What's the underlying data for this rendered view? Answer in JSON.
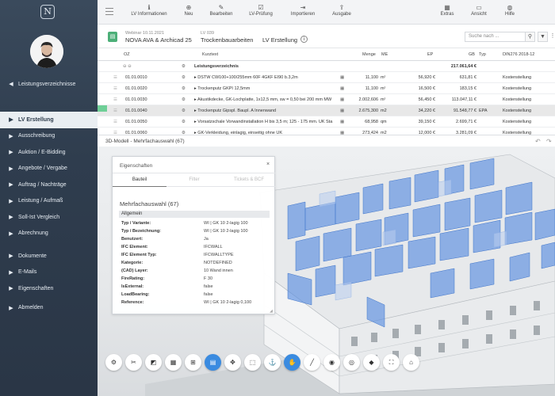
{
  "sidebar": {
    "logo": "N",
    "items": [
      {
        "label": "Leistungsverzeichnisse",
        "icon": "chevron-left-icon",
        "glyph": "◀"
      },
      {
        "label": "LV Erstellung",
        "icon": "chevron-right-icon",
        "glyph": "▶"
      },
      {
        "label": "Ausschreibung",
        "icon": "chevron-right-icon",
        "glyph": "▶"
      },
      {
        "label": "Auktion / E-Bidding",
        "icon": "chevron-right-icon",
        "glyph": "▶"
      },
      {
        "label": "Angebote / Vergabe",
        "icon": "chevron-right-icon",
        "glyph": "▶"
      },
      {
        "label": "Auftrag / Nachträge",
        "icon": "chevron-right-icon",
        "glyph": "▶"
      },
      {
        "label": "Leistung / Aufmaß",
        "icon": "chevron-right-icon",
        "glyph": "▶"
      },
      {
        "label": "Soll-Ist Vergleich",
        "icon": "chevron-right-icon",
        "glyph": "▶"
      },
      {
        "label": "Abrechnung",
        "icon": "chevron-right-icon",
        "glyph": "▶"
      },
      {
        "label": "Dokumente",
        "icon": "chevron-right-icon",
        "glyph": "▶"
      },
      {
        "label": "E-Mails",
        "icon": "chevron-right-icon",
        "glyph": "▶"
      },
      {
        "label": "Eigenschaften",
        "icon": "chevron-right-icon",
        "glyph": "▶"
      },
      {
        "label": "Abmelden",
        "icon": "chevron-right-icon",
        "glyph": "▶"
      }
    ]
  },
  "toolbar": {
    "buttons": [
      {
        "label": "LV Informationen",
        "icon": "info-icon",
        "glyph": "ℹ"
      },
      {
        "label": "Neu",
        "icon": "plus-circle-icon",
        "glyph": "⊕"
      },
      {
        "label": "Bearbeiten",
        "icon": "pencil-icon",
        "glyph": "✎"
      },
      {
        "label": "LV-Prüfung",
        "icon": "check-square-icon",
        "glyph": "☑"
      },
      {
        "label": "Importieren",
        "icon": "import-icon",
        "glyph": "⇥"
      },
      {
        "label": "Ausgabe",
        "icon": "export-icon",
        "glyph": "⇪"
      },
      {
        "label": "Extras",
        "icon": "calculator-icon",
        "glyph": "▦"
      },
      {
        "label": "Ansicht",
        "icon": "view-icon",
        "glyph": "▭"
      },
      {
        "label": "Hilfe",
        "icon": "lifebuoy-icon",
        "glyph": "◍"
      }
    ]
  },
  "header": {
    "project_date": "Webinar 10.11.2021",
    "project_name": "NOVA AVA & Archicad 25",
    "lv_code": "LV 039",
    "lv_name": "Trockenbauarbeiten",
    "lv_mode": "LV Erstellung",
    "search_placeholder": "Suche nach ..."
  },
  "table": {
    "headers": {
      "oz": "OZ",
      "kurztext": "Kurztext",
      "menge": "Menge",
      "me": "ME",
      "ep": "EP",
      "gb": "GB",
      "typ": "Typ",
      "din": "DIN276 2018-12"
    },
    "title_row": {
      "kurztext": "Leistungsverzeichnis",
      "gb": "217.061,64 €"
    },
    "rows": [
      {
        "oz": "01.01.0010",
        "kurztext": "DSTW CW100+100/255mm 60F 4GKF EI90 b.3,2m",
        "menge": "11,100",
        "me": "m²",
        "ep": "56,920 €",
        "gb": "631,81 €",
        "typ": "",
        "din": "Kostenstellung"
      },
      {
        "oz": "01.01.0020",
        "kurztext": "Trockenputz GKPI 12,5mm",
        "menge": "11,100",
        "me": "m²",
        "ep": "16,500 €",
        "gb": "183,15 €",
        "typ": "",
        "din": "Kostenstellung"
      },
      {
        "oz": "01.01.0030",
        "kurztext": "Akustikdecke, GK-Lochplatte, 1x12,5 mm, sw = 0,50 bei 200 mm MW",
        "menge": "2.002,606",
        "me": "m²",
        "ep": "56,450 €",
        "gb": "113.047,11 €",
        "typ": "",
        "din": "Kostenstellung"
      },
      {
        "oz": "01.01.0040",
        "kurztext": "Trockenputz Gipspl. Baupl. A Innenwand",
        "menge": "2.675,300",
        "me": "m2",
        "ep": "34,220 €",
        "gb": "91.548,77 €",
        "typ": "EPA",
        "din": "Kostenstellung"
      },
      {
        "oz": "01.01.0050",
        "kurztext": "Vorsatzschale Vorwandinstallation H bis 3,5 m; 125 - 175 mm. UK Sta",
        "menge": "68,958",
        "me": "qm",
        "ep": "39,150 €",
        "gb": "2.699,71 €",
        "typ": "",
        "din": "Kostenstellung"
      },
      {
        "oz": "01.01.0060",
        "kurztext": "GK-Verkleidung, einlagig, einseitig ohne UK",
        "menge": "273,424",
        "me": "m2",
        "ep": "12,000 €",
        "gb": "3.281,09 €",
        "typ": "",
        "din": "Kostenstellung"
      }
    ]
  },
  "viewer": {
    "title": "3D-Modell - Mehrfachauswahl (67)",
    "props": {
      "title": "Eigenschaften",
      "tabs": [
        "Bauteil",
        "Filter",
        "Tickets & BCF"
      ],
      "selection": "Mehrfachauswahl (67)",
      "group": "Allgemein",
      "fields": [
        {
          "k": "Typ / Variante:",
          "v": "WI | GK 10 2-lagig 100"
        },
        {
          "k": "Typ / Bezeichnung:",
          "v": "WI | GK 10 2-lagig 100"
        },
        {
          "k": "Benutzert:",
          "v": "Ja"
        },
        {
          "k": "IFC Element:",
          "v": "IFCWALL"
        },
        {
          "k": "IFC Element Typ:",
          "v": "IFCWALLTYPE"
        },
        {
          "k": "Kategorie:",
          "v": "NOTDEFINED"
        },
        {
          "k": "(CAD) Layer:",
          "v": "10 Wand innen"
        },
        {
          "k": "FireRating:",
          "v": "F 30"
        },
        {
          "k": "IsExternal:",
          "v": "false"
        },
        {
          "k": "LoadBearing:",
          "v": "false"
        },
        {
          "k": "Reference:",
          "v": "WI | GK 10 2-lagig 0,100"
        }
      ]
    },
    "tools": [
      {
        "icon": "settings-icon",
        "glyph": "⚙"
      },
      {
        "icon": "tools-icon",
        "glyph": "✂"
      },
      {
        "icon": "section-icon",
        "glyph": "◩"
      },
      {
        "icon": "grid-icon",
        "glyph": "▦"
      },
      {
        "icon": "tree-icon",
        "glyph": "⊞"
      },
      {
        "icon": "clipboard-icon",
        "glyph": "▤"
      },
      {
        "icon": "move-icon",
        "glyph": "✥"
      },
      {
        "icon": "select-box-icon",
        "glyph": "⬚"
      },
      {
        "icon": "anchor-icon",
        "glyph": "⚓"
      },
      {
        "icon": "hand-icon",
        "glyph": "✋"
      },
      {
        "icon": "measure-icon",
        "glyph": "╱"
      },
      {
        "icon": "eye-icon",
        "glyph": "◉"
      },
      {
        "icon": "globe-icon",
        "glyph": "◎"
      },
      {
        "icon": "cube-icon",
        "glyph": "◆"
      },
      {
        "icon": "fullscreen-icon",
        "glyph": "⛶"
      },
      {
        "icon": "home-icon",
        "glyph": "⌂"
      }
    ]
  }
}
